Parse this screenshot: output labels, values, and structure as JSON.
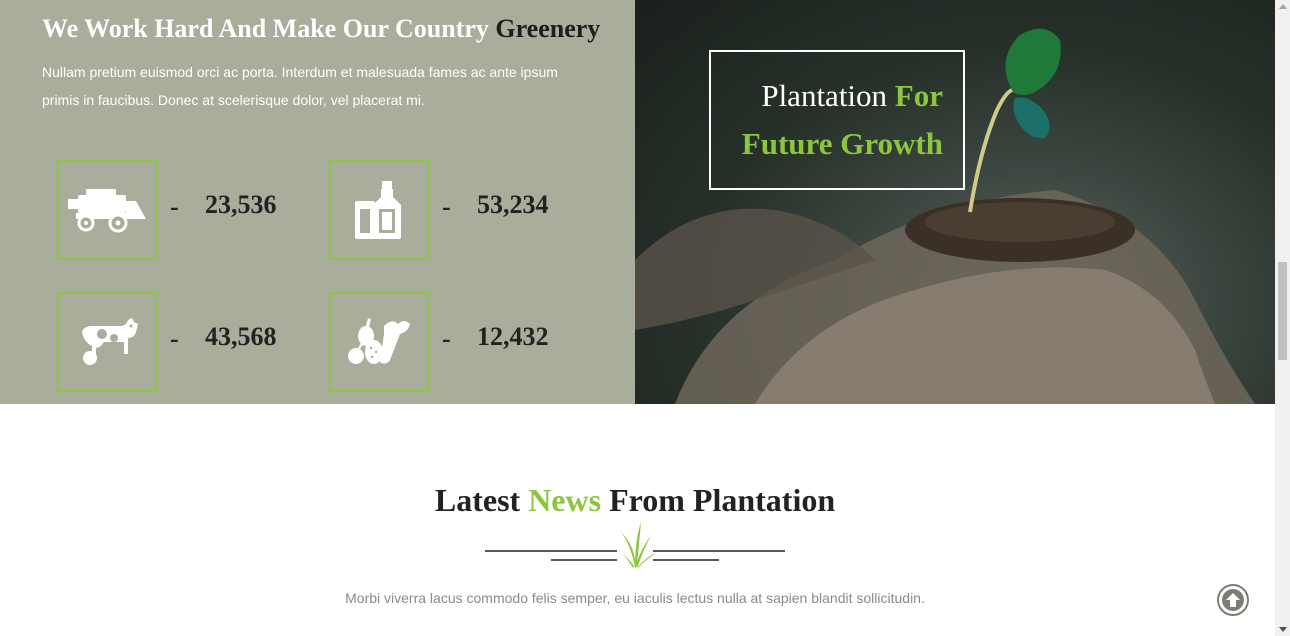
{
  "stats_section": {
    "title_part1": "We Work Hard And Make Our Country",
    "title_part2": "Greenery",
    "description": "Nullam pretium euismod orci ac porta. Interdum et malesuada fames ac ante ipsum primis in faucibus. Donec at scelerisque dolor, vel placerat mi.",
    "stats": [
      {
        "icon": "harvester-icon",
        "dash": "-",
        "value": "23,536"
      },
      {
        "icon": "milk-bottles-icon",
        "dash": "-",
        "value": "53,234"
      },
      {
        "icon": "cow-icon",
        "dash": "-",
        "value": "43,568"
      },
      {
        "icon": "fruits-vegetables-icon",
        "dash": "-",
        "value": "12,432"
      }
    ]
  },
  "hero": {
    "line1_part1": "Plantation",
    "line1_part2": "For",
    "line2": "Future Growth",
    "image": "hands-holding-seedling-image"
  },
  "news_section": {
    "title_part1": "Latest",
    "title_part2": "News",
    "title_part3": "From Plantation",
    "divider_icon": "grass-icon",
    "description": "Morbi viverra lacus commodo felis semper, eu iaculis lectus nulla at sapien blandit sollicitudin."
  },
  "back_to_top": {
    "icon": "arrow-up-circle-icon"
  },
  "colors": {
    "accent": "#8cc63f",
    "panel_bg": "#a9ad9b",
    "heading_dark": "#222222",
    "muted_text": "#8a8a8a"
  }
}
